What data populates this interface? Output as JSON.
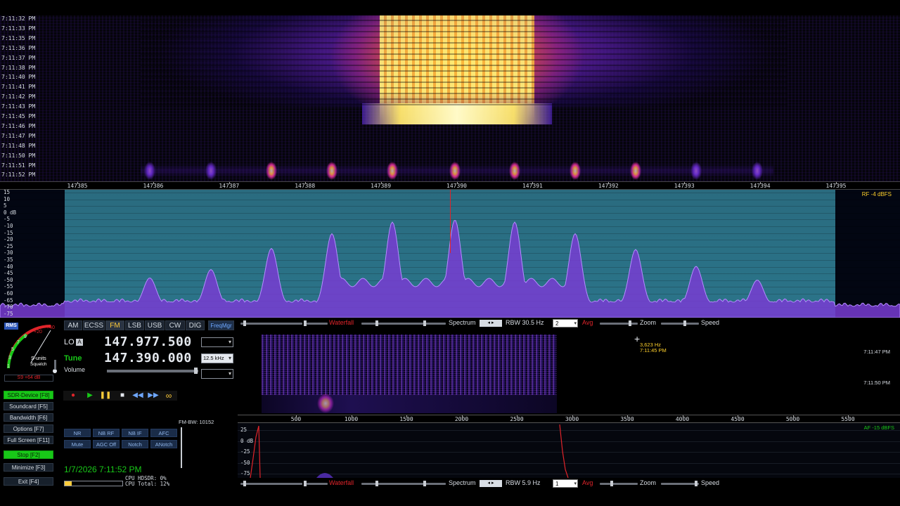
{
  "rf_waterfall": {
    "times": [
      "7:11:32 PM",
      "7:11:33 PM",
      "7:11:35 PM",
      "7:11:36 PM",
      "7:11:37 PM",
      "7:11:38 PM",
      "7:11:40 PM",
      "7:11:41 PM",
      "7:11:42 PM",
      "7:11:43 PM",
      "7:11:45 PM",
      "7:11:46 PM",
      "7:11:47 PM",
      "7:11:48 PM",
      "7:11:50 PM",
      "7:11:51 PM",
      "7:11:52 PM"
    ]
  },
  "rf_axis": {
    "ticks": [
      "147385",
      "147386",
      "147387",
      "147388",
      "147389",
      "147390",
      "147391",
      "147392",
      "147393",
      "147394",
      "147395"
    ]
  },
  "rf_spectrum": {
    "db_labels": [
      "15",
      "10",
      "5",
      "0 dB",
      "-5",
      "-10",
      "-15",
      "-20",
      "-25",
      "-30",
      "-35",
      "-40",
      "-45",
      "-50",
      "-55",
      "-60",
      "-65",
      "-70",
      "-75"
    ],
    "level": "RF -4 dBFS"
  },
  "rf_strip": {
    "waterfall_label": "Waterfall",
    "spectrum_label": "Spectrum",
    "rbw_label": "RBW 30.5 Hz",
    "avg_value": "2",
    "avg_label": "Avg",
    "zoom_label": "Zoom",
    "speed_label": "Speed",
    "arrows": "◂ ▸"
  },
  "smeter": {
    "rms_label": "RMS",
    "scale_labels": [
      "+40",
      "+20",
      "9",
      "7",
      "5",
      "3",
      "1"
    ],
    "title": "S-units",
    "subtitle": "Squelch",
    "reading": "S9 +64 dB"
  },
  "modes": [
    {
      "label": "AM",
      "active": false
    },
    {
      "label": "ECSS",
      "active": false
    },
    {
      "label": "FM",
      "active": true
    },
    {
      "label": "LSB",
      "active": false
    },
    {
      "label": "USB",
      "active": false
    },
    {
      "label": "CW",
      "active": false
    },
    {
      "label": "DIG",
      "active": false
    }
  ],
  "freqmgr_label": "FreqMgr",
  "lo": {
    "label": "LO",
    "badge": "A",
    "value": "147.977.500"
  },
  "tune": {
    "label": "Tune",
    "value": "147.390.000",
    "step": "12.5 kHz"
  },
  "volume_label": "Volume",
  "side_buttons": [
    {
      "label": "SDR-Device  [F8]",
      "green": true
    },
    {
      "label": "Soundcard  [F5]",
      "green": false
    },
    {
      "label": "Bandwidth  [F6]",
      "green": false
    },
    {
      "label": "Options  [F7]",
      "green": false
    },
    {
      "label": "Full Screen  [F11]",
      "green": false
    },
    {
      "label": "Stop  [F2]",
      "green": true
    },
    {
      "label": "Minimize  [F3]",
      "green": false
    },
    {
      "label": "Exit  [F4]",
      "green": false
    }
  ],
  "fm_bw": "FM-BW: 10152",
  "dsp_buttons": [
    "NR",
    "NB RF",
    "NB IF",
    "AFC",
    "Mute",
    "AGC Off",
    "Notch",
    "ANotch"
  ],
  "datetime": "1/7/2026 7:11:52 PM",
  "cpu": {
    "hdsdr": "CPU HDSDR:  0%",
    "total": "CPU Total: 12%"
  },
  "af_waterfall": {
    "cursor_freq": "3,623 Hz",
    "cursor_time": "7:11:45 PM",
    "times": [
      "7:11:47 PM",
      "7:11:50 PM"
    ]
  },
  "af_axis": {
    "ticks": [
      "500",
      "1000",
      "1500",
      "2000",
      "2500",
      "3000",
      "3500",
      "4000",
      "4500",
      "5000",
      "5500"
    ]
  },
  "af_spectrum": {
    "db_labels": [
      "25",
      "0 dB",
      "-25",
      "-50",
      "-75"
    ],
    "level": "AF -15 dBFS"
  },
  "af_strip": {
    "waterfall_label": "Waterfall",
    "spectrum_label": "Spectrum",
    "rbw_label": "RBW  5.9 Hz",
    "avg_value": "1",
    "avg_label": "Avg",
    "zoom_label": "Zoom",
    "speed_label": "Speed",
    "arrows": "◂ ▸"
  },
  "colors": {
    "accent_yellow": "#ffcc3a",
    "green": "#18c818",
    "spectrum_bg": "#2a7186",
    "trace": "#7a3ce0"
  }
}
